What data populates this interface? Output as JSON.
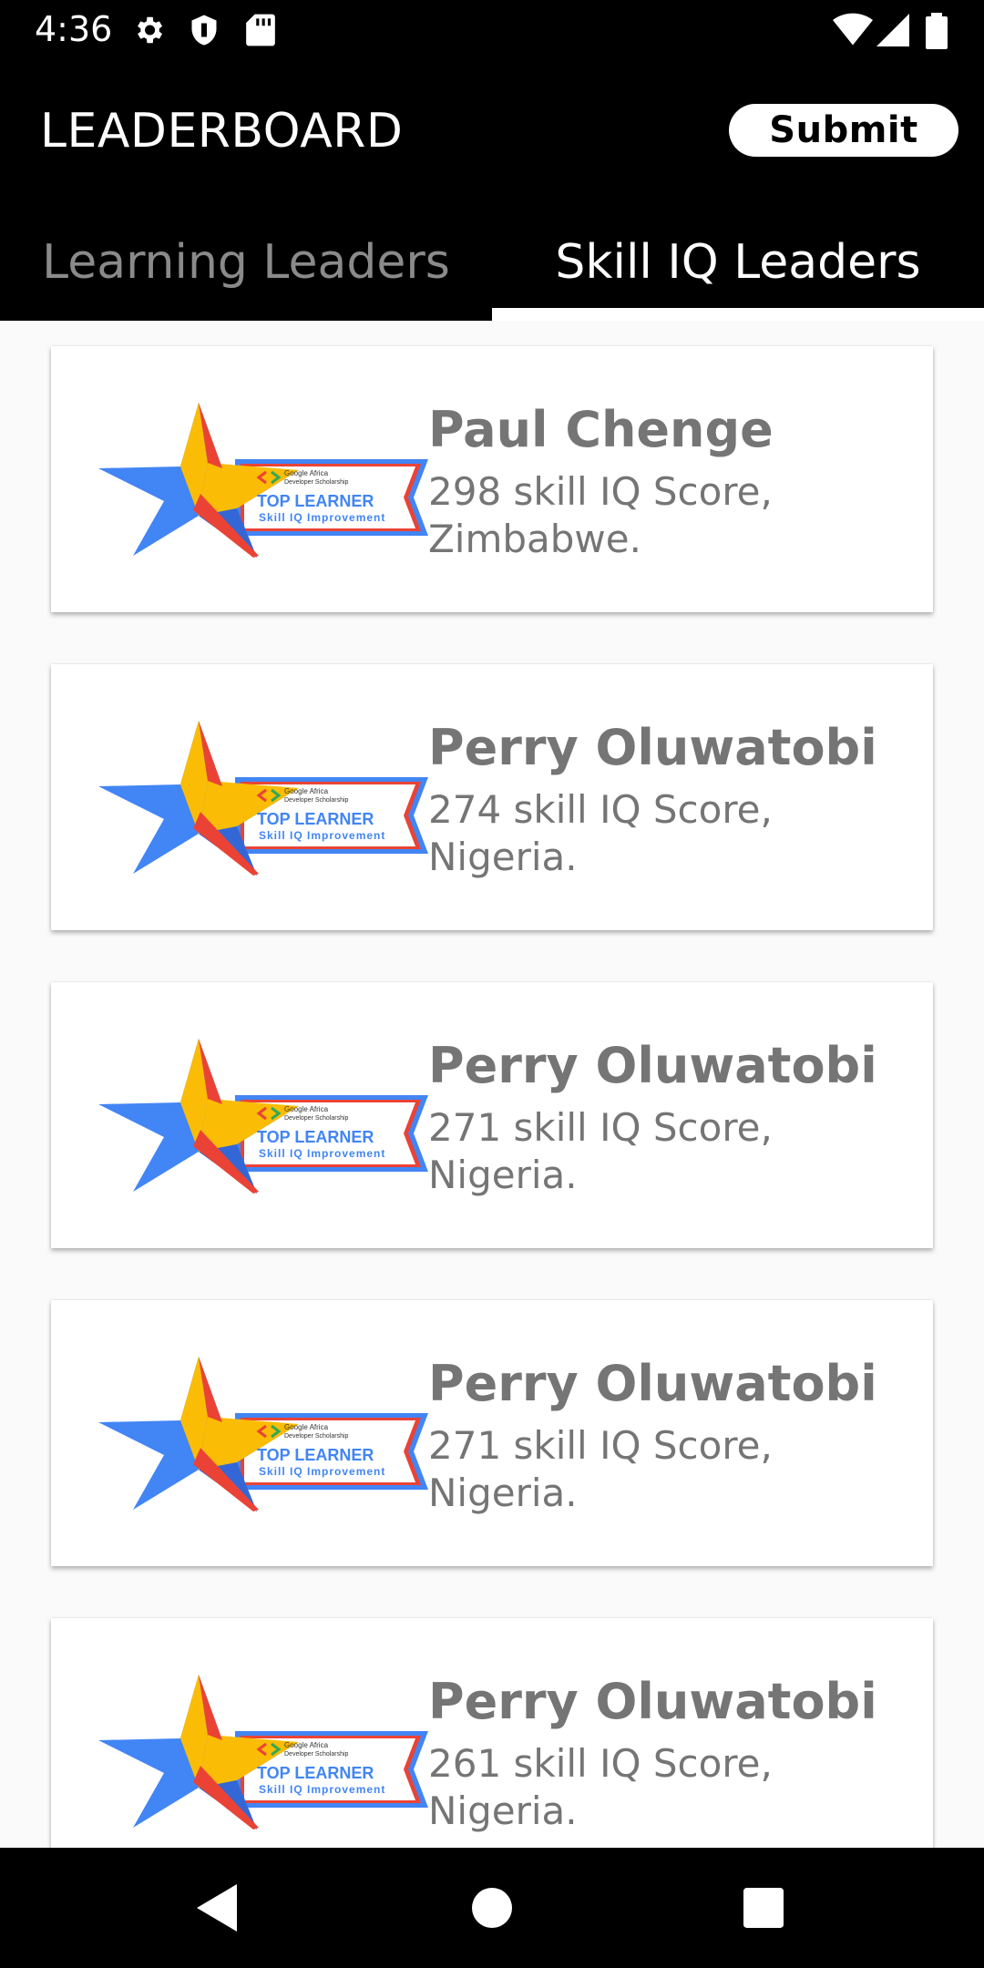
{
  "status_bar": {
    "time": "4:36",
    "left_icons": [
      "gear-icon",
      "shield-icon",
      "sd-card-icon"
    ],
    "right_icons": [
      "wifi-icon",
      "signal-icon",
      "battery-icon"
    ]
  },
  "app_bar": {
    "title": "LEADERBOARD",
    "submit_label": "Submit"
  },
  "tabs": [
    {
      "label": "Learning Leaders",
      "active": false
    },
    {
      "label": "Skill IQ Leaders",
      "active": true
    }
  ],
  "leaders": [
    {
      "name": "Paul Chenge",
      "score": "298 skill IQ Score,",
      "country": "Zimbabwe."
    },
    {
      "name": "Perry Oluwatobi",
      "score": "274 skill IQ Score,",
      "country": "Nigeria."
    },
    {
      "name": "Perry Oluwatobi",
      "score": "271 skill IQ Score,",
      "country": "Nigeria."
    },
    {
      "name": "Perry Oluwatobi",
      "score": "271 skill IQ Score,",
      "country": "Nigeria."
    },
    {
      "name": "Perry Oluwatobi",
      "score": "261 skill IQ Score,",
      "country": "Nigeria."
    }
  ],
  "badge": {
    "org_line1": "Google Africa",
    "org_line2": "Developer Scholarship",
    "title": "TOP LEARNER",
    "subtitle": "Skill IQ Improvement"
  },
  "colors": {
    "star_blue": "#4285f4",
    "star_yellow": "#fbbc05",
    "accent_red": "#ea4335",
    "app_bar_bg": "#000000",
    "card_text": "#757575"
  },
  "nav_bar": {
    "icons": [
      "back-icon",
      "home-icon",
      "recents-icon"
    ]
  }
}
